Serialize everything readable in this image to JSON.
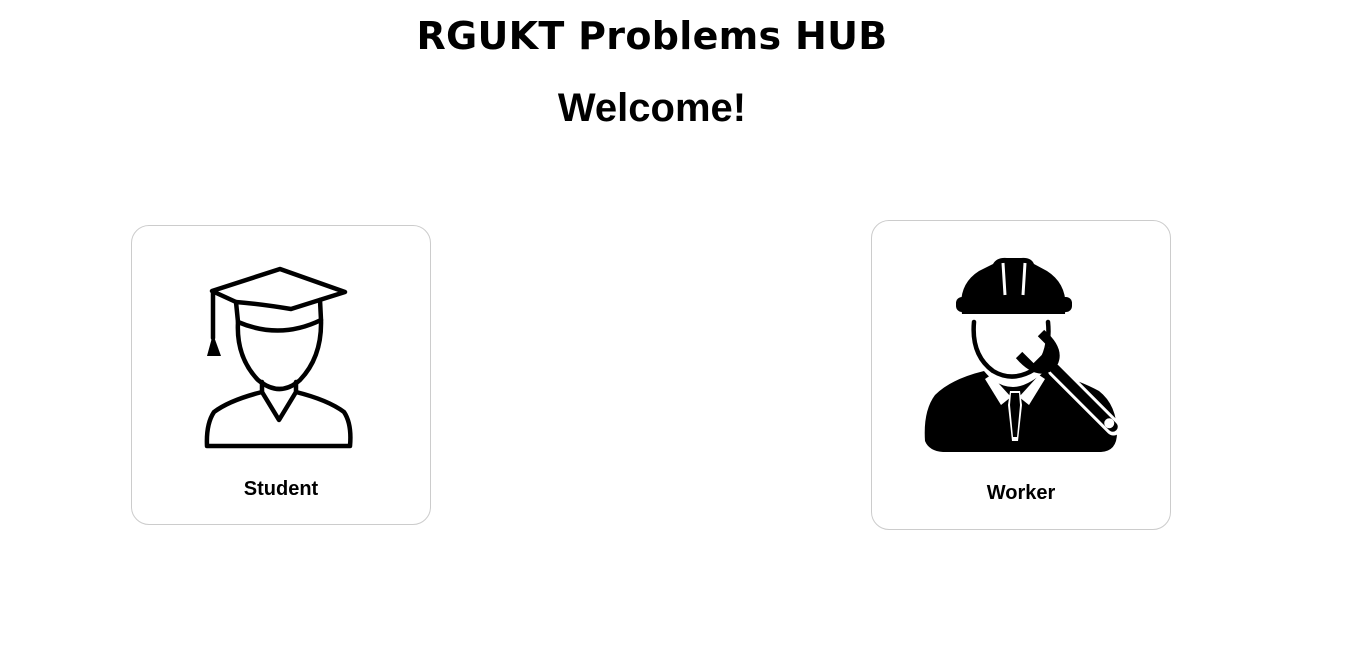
{
  "header": {
    "title": "RGUKT Problems HUB",
    "welcome": "Welcome!"
  },
  "cards": [
    {
      "label": "Student",
      "icon": "graduate-student-icon"
    },
    {
      "label": "Worker",
      "icon": "worker-wrench-icon"
    }
  ],
  "colors": {
    "background": "#ffffff",
    "card_border": "#cccccc",
    "text": "#000000"
  }
}
